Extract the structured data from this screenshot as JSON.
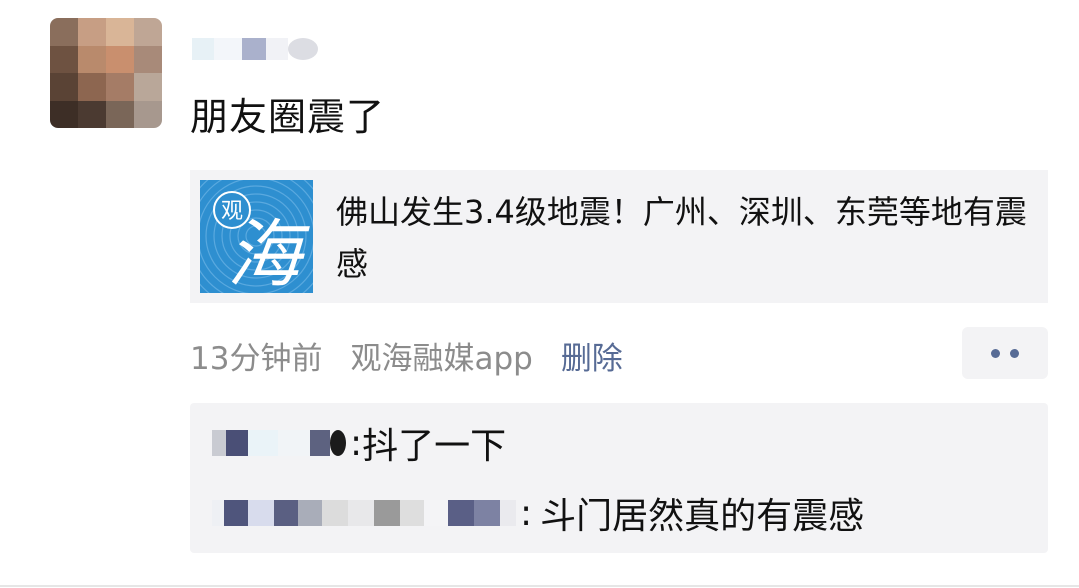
{
  "post": {
    "text": "朋友圈震了",
    "timestamp": "13分钟前",
    "source": "观海融媒app",
    "delete_label": "删除",
    "more_icon": "more-dots-icon"
  },
  "link_card": {
    "thumbnail_big_char": "海",
    "thumbnail_small_char": "观",
    "title": "佛山发生3.4级地震！广州、深圳、东莞等地有震感"
  },
  "comments": [
    {
      "separator": ":",
      "text": "抖了一下"
    },
    {
      "separator": ":",
      "text": "斗门居然真的有震感"
    }
  ],
  "colors": {
    "link_blue": "#576b95",
    "card_bg": "#f3f3f5",
    "meta_gray": "#8c8c8c",
    "thumb_blue": "#2e8fd0"
  }
}
